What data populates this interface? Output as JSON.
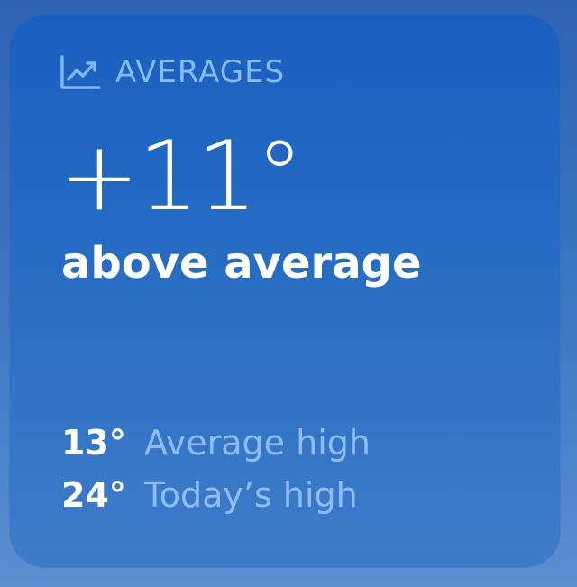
{
  "widget": {
    "section_title": "AVERAGES",
    "section_icon": "trend-chart-icon",
    "difference_value": "+11°",
    "difference_label": "above average",
    "stats": [
      {
        "value": "13°",
        "label": "Average high"
      },
      {
        "value": "24°",
        "label": "Today’s high"
      }
    ]
  },
  "colors": {
    "card_background": "#2167c2",
    "header_text": "#86bbf3",
    "primary_text": "#ffffff",
    "secondary_text": "#8cbef4"
  }
}
